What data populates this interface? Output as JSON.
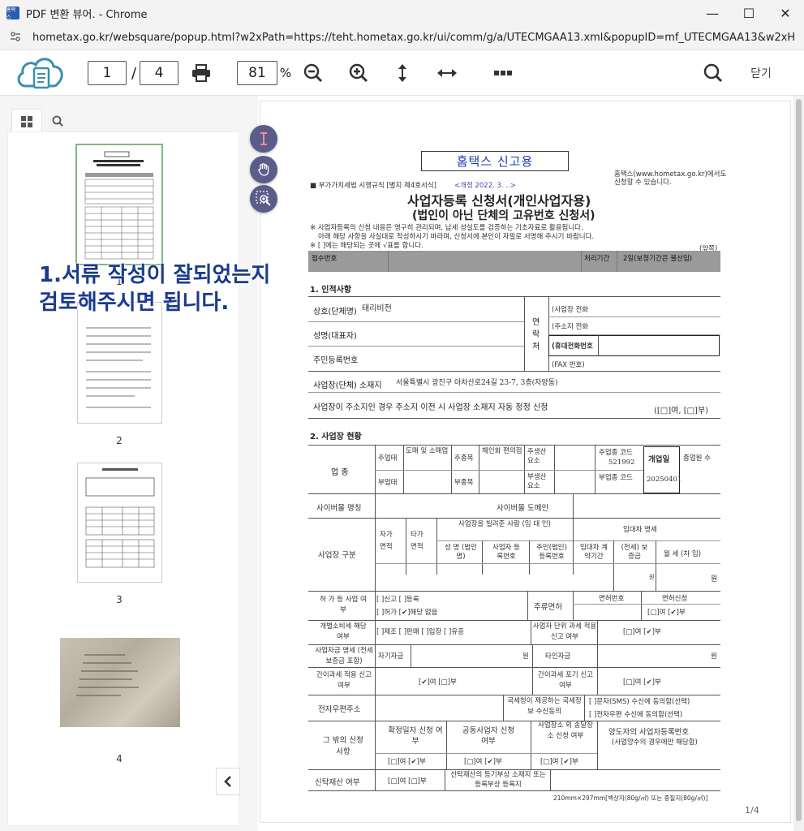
{
  "window": {
    "title": "PDF 변환 뷰어. - Chrome",
    "favicon": "홈택스",
    "minimize": "—",
    "maximize": "☐",
    "close": "✕"
  },
  "urlbar": {
    "url": "hometax.go.kr/websquare/popup.html?w2xPath=https://teht.hometax.go.kr/ui/comm/g/a/UTECMGAA13.xml&popupID=mf_UTECMGAA13&w2xHo..."
  },
  "toolbar": {
    "page_current": "1",
    "page_sep": "/",
    "page_total": "4",
    "zoom": "81",
    "zoom_unit": "%",
    "close_label": "닫기"
  },
  "sidebar": {
    "thumbs": [
      {
        "label": "1"
      },
      {
        "label": "2"
      },
      {
        "label": "3"
      },
      {
        "label": "4"
      }
    ]
  },
  "overlay": {
    "line1": "1.서류 작성이 잘되었는지",
    "line2": "검토해주시면 됩니다."
  },
  "doc": {
    "stamp": "홈택스 신고용",
    "hometax_note1": "홈택스(www.hometax.go.kr)에서도",
    "hometax_note2": "신청할 수 있습니다.",
    "form_ref": "■ 부가가치세법 시행규칙 [별지 제4호서식]",
    "revision": "<개정 2022. 3. ..>",
    "title1": "사업자등록 신청서(개인사업자용)",
    "title2": "(법인이 아닌 단체의 고유번호 신청서)",
    "note1": "※ 사업자등록의 신청 내용은 영구히 관리되며, 납세 성실도를 검증하는 기초자료로 활용됩니다.",
    "note2": "아래 해당 사항을 사실대로 작성하시기 바라며, 신청서에 본인이 자필로 서명해 주시기 바랍니다.",
    "note3": "※ [ ]에는 해당되는 곳에 √표를 합니다.",
    "page_side": "(앞쪽)",
    "receipt_no": "접수번호",
    "proc_period": "처리기간",
    "proc_days": "2일(보정기간은 불산입)",
    "sec1": "1. 인적사항",
    "trade_name": "상호(단체명)",
    "trade_name_val": "태리비전",
    "rep_name": "성명(대표자)",
    "reg_no": "주민등록번호",
    "contact": "연락처",
    "phone_biz": "(사업장 전화",
    "phone_home": "(주소지 전화",
    "phone_mobile": "(휴대전화번호",
    "fax": "(FAX 번호)",
    "biz_addr": "사업장(단체) 소재지",
    "biz_addr_val": "서울특별시 광진구 아차산로24길 23-7, 3층(자양동)",
    "addr_auto": "사업장이 주소지인 경우 주소지 이전 시 사업장 소재지 자동 정정 신청",
    "yes_no": "([□]여, [□]부)",
    "sec2": "2. 사업장 현황",
    "industry": "업 종",
    "main_type": "주업태",
    "main_type_val": "도매 및 소매업",
    "main_item": "주종목",
    "main_item_val": "체인화 편의점",
    "main_prod": "주생산 요소",
    "main_code": "주업종 코드",
    "main_code_val": "521992",
    "open_date": "개업일",
    "open_date_val": "20250401",
    "employees": "종업원 수",
    "sub_type": "부업태",
    "sub_item": "부종목",
    "sub_prod": "부생산 요소",
    "sub_code": "부업종 코드",
    "cyber_name": "사이버몰 명칭",
    "cyber_domain": "사이버몰 도메인",
    "biz_place": "사업장 구분",
    "own_area": "자가 면적",
    "rent_area": "타가 면적",
    "lessor": "사업장을 빌려준 사람 (임 대 인)",
    "lessor_name": "성 명 (법인명)",
    "lessor_bizno": "사업자 등록번호",
    "lessor_regno": "주민(법인) 등록번호",
    "lease_detail": "임대차 명세",
    "lease_period": "임대차 계약기간",
    "deposit": "(전세) 보증금",
    "monthly": "월 세 (차 임)",
    "won1": "원",
    "won2": "원",
    "permit": "허 가 등 사업 여부",
    "permit_opts1": "[ ]신고   [ ]등록",
    "permit_opts2": "[ ]허가   [✔]해당 없음",
    "liquor": "주류면허",
    "license_no": "면허번호",
    "license_apply": "면허신청",
    "license_yn": "[□]여 [✔]부",
    "excise": "개별소비세 해당 여부",
    "excise_opts": "[ ]제조 [ ]판매 [ ]입장 [ ]유흥",
    "unit_tax": "사업자 단위 과세 적용 신고 여부",
    "unit_tax_yn": "[□]여   [✔]부",
    "fund": "사업자금 명세 (전세보증금 포함)",
    "own_fund": "자기자금",
    "won3": "원",
    "other_fund": "타인자금",
    "won4": "원",
    "simple_tax": "간이과세 적용 신고 여부",
    "simple_yn": "[✔]여   [□]부",
    "simple_waive": "간이과세 포기 신고 여부",
    "waive_yn": "[□]여   [✔]부",
    "email": "전자우편주소",
    "nts_info": "국세청이 제공하는 국세정보 수신동의",
    "sms_opt": "[ ]문자(SMS) 수신에 동의함(선택)",
    "email_opt": "[ ]전자우편 수신에 동의함(선택)",
    "other": "그 밖의 신청사항",
    "confirm_date": "확정일자 신청 여부",
    "joint": "공동사업자 신청 여부",
    "delivery": "사업장소 외 송달장소 신청 여부",
    "transferor": "양도자의 사업자등록번호",
    "transferor_sub": "(사업양수의 경우에만 해당함)",
    "opt_a": "[□]여 [✔]부",
    "opt_b": "[□]여 [✔]부",
    "opt_c": "[□]여 [✔]부",
    "trust": "신탁재산 여부",
    "trust_yn": "[□]여 [□]부",
    "trust_reg": "신탁재산의 등기부상 소재지 또는 등록부상 등록지",
    "paper": "210mm×297mm[백상지(80g/㎡) 또는 중질지(80g/㎡)]",
    "page_ind": "1/4"
  }
}
